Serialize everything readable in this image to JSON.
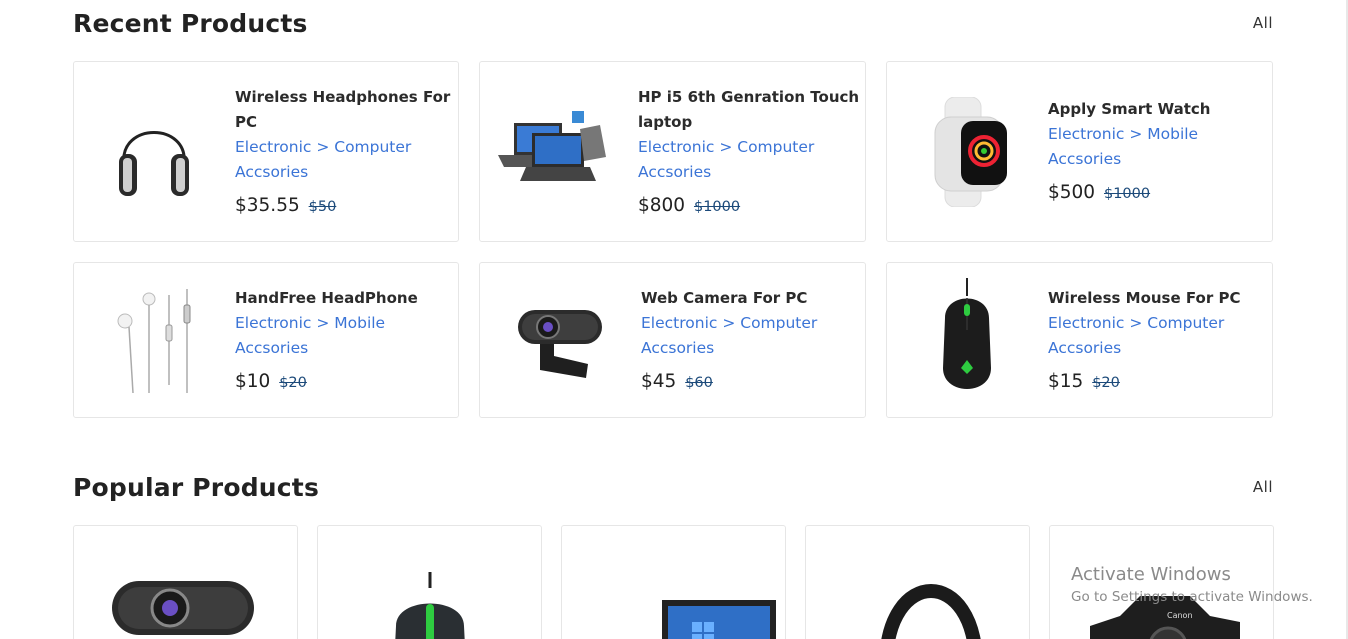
{
  "recent": {
    "title": "Recent Products",
    "all_label": "All",
    "products": [
      {
        "name": "Wireless Headphones For PC",
        "category": "Electronic > Computer Accsories",
        "price": "$35.55",
        "old_price": "$50",
        "icon": "headphones-icon"
      },
      {
        "name": "HP i5 6th Genration Touch laptop",
        "category": "Electronic > Computer Accsories",
        "price": "$800",
        "old_price": "$1000",
        "icon": "laptop-icon"
      },
      {
        "name": "Apply Smart Watch",
        "category": "Electronic > Mobile Accsories",
        "price": "$500",
        "old_price": "$1000",
        "icon": "smartwatch-icon"
      },
      {
        "name": "HandFree HeadPhone",
        "category": "Electronic > Mobile Accsories",
        "price": "$10",
        "old_price": "$20",
        "icon": "earphones-icon"
      },
      {
        "name": "Web Camera For PC",
        "category": "Electronic > Computer Accsories",
        "price": "$45",
        "old_price": "$60",
        "icon": "webcam-icon"
      },
      {
        "name": "Wireless Mouse For PC",
        "category": "Electronic > Computer Accsories",
        "price": "$15",
        "old_price": "$20",
        "icon": "mouse-icon"
      }
    ]
  },
  "popular": {
    "title": "Popular Products",
    "all_label": "All",
    "items": [
      {
        "icon": "webcam-icon"
      },
      {
        "icon": "gaming-mouse-icon"
      },
      {
        "icon": "laptop-icon"
      },
      {
        "icon": "headphones-icon"
      },
      {
        "icon": "camera-icon",
        "brand": "Canon"
      }
    ]
  },
  "watermark": {
    "line1": "Activate Windows",
    "line2": "Go to Settings to activate Windows."
  },
  "colors": {
    "category_link": "#3b74d6",
    "old_price": "#1c4a7a",
    "border": "#e6e6e6"
  }
}
